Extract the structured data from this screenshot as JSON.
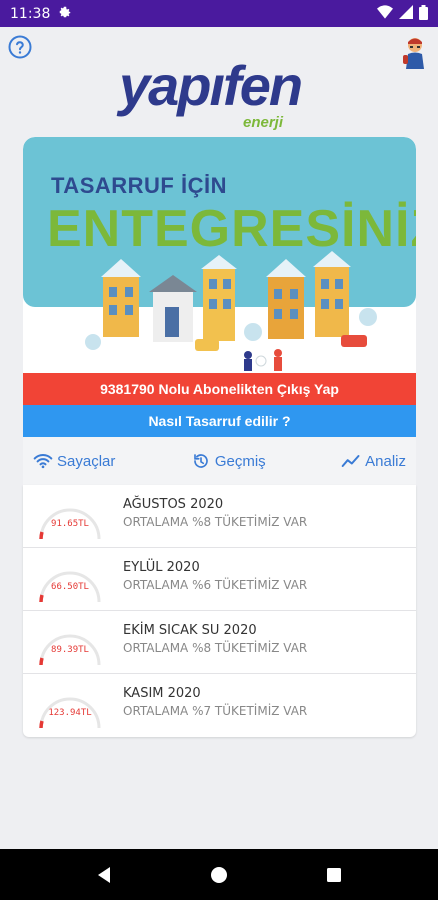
{
  "status": {
    "time": "11:38",
    "icons": [
      "gear-icon",
      "wifi-icon",
      "signal-icon",
      "battery-icon"
    ]
  },
  "header": {
    "logo_main": "yapıfen",
    "logo_sub": "enerji"
  },
  "banner": {
    "line1": "TASARRUF İÇİN",
    "line2": "ENTEGRESİNİZ!"
  },
  "buttons": {
    "exit": "9381790 Nolu Abonelikten Çıkış Yap",
    "howto": "Nasıl Tasarruf edilir ?"
  },
  "tabs": [
    {
      "label": "Sayaçlar",
      "icon": "wifi-icon"
    },
    {
      "label": "Geçmiş",
      "icon": "history-icon"
    },
    {
      "label": "Analiz",
      "icon": "chart-line-icon"
    }
  ],
  "entries": [
    {
      "title": "AĞUSTOS 2020",
      "subtitle": "ORTALAMA %8 TÜKETİMİZ VAR",
      "amount": "91.65TL"
    },
    {
      "title": "EYLÜL 2020",
      "subtitle": "ORTALAMA %6 TÜKETİMİZ VAR",
      "amount": "66.50TL"
    },
    {
      "title": "EKİM SICAK SU 2020",
      "subtitle": "ORTALAMA %8 TÜKETİMİZ VAR",
      "amount": "89.39TL"
    },
    {
      "title": "KASIM 2020",
      "subtitle": "ORTALAMA %7 TÜKETİMİZ VAR",
      "amount": "123.94TL"
    }
  ],
  "colors": {
    "statusbar": "#4a1a9e",
    "red": "#f14436",
    "blue": "#2f97f0",
    "accent": "#3a7bd5",
    "logo_blue": "#2e3a8c",
    "logo_green": "#7cb83a"
  }
}
